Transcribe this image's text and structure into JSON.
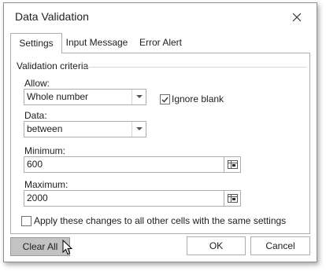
{
  "dialog": {
    "title": "Data Validation"
  },
  "tabs": [
    {
      "label": "Settings",
      "active": true
    },
    {
      "label": "Input Message",
      "active": false
    },
    {
      "label": "Error Alert",
      "active": false
    }
  ],
  "criteria": {
    "group_title": "Validation criteria",
    "allow_label": "Allow:",
    "allow_value": "Whole number",
    "ignore_blank_label": "Ignore blank",
    "ignore_blank_checked": true,
    "data_label": "Data:",
    "data_value": "between",
    "minimum_label": "Minimum:",
    "minimum_value": "600",
    "maximum_label": "Maximum:",
    "maximum_value": "2000"
  },
  "apply_all_label": "Apply these changes to all other cells with the same settings",
  "apply_all_checked": false,
  "buttons": {
    "clear_all": "Clear All",
    "ok": "OK",
    "cancel": "Cancel"
  },
  "icons": {
    "close": "close-icon",
    "dropdown": "chevron-down-icon",
    "range_select": "range-select-icon",
    "check": "check-icon",
    "cursor": "mouse-pointer-icon"
  }
}
